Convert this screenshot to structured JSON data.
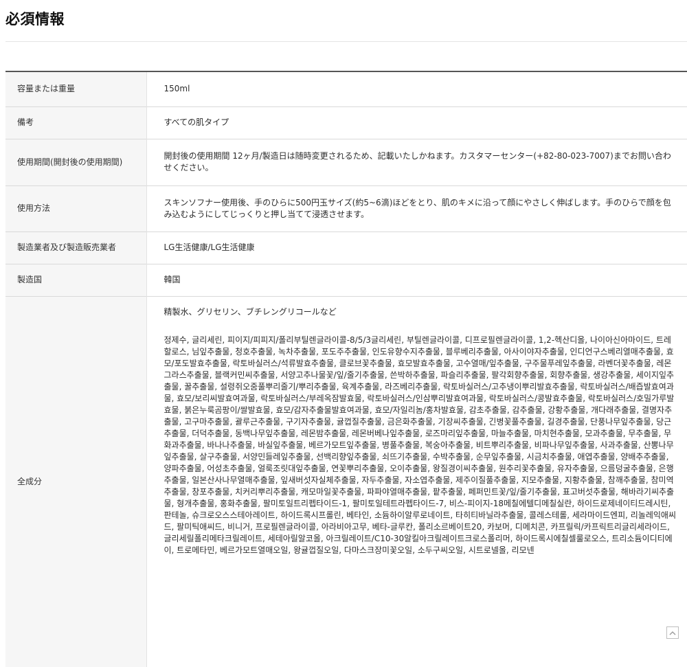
{
  "page": {
    "title": "必須情報"
  },
  "rows": [
    {
      "label": "容量または重量",
      "value": "150ml"
    },
    {
      "label": "備考",
      "value": "すべての肌タイプ"
    },
    {
      "label": "使用期間(開封後の使用期間)",
      "value": "開封後の使用期間 12ヶ月/製造日は随時変更されるため、記載いたしかねます。カスタマーセンター(+82-80-023-7007)までお問い合わせください。"
    },
    {
      "label": "使用方法",
      "value": "スキンソフナー使用後、手のひらに500円玉サイズ(約5~6滴)ほどをとり、肌のキメに沿って顔にやさしく伸ばします。手のひらで顔を包み込むようにしてじっくりと押し当てて浸透させます。"
    },
    {
      "label": "製造業者及び製造販売業者",
      "value": "LG生活健康/LG生活健康"
    },
    {
      "label": "製造国",
      "value": "韓国"
    }
  ],
  "ingredients": {
    "label": "全成分",
    "summary_ja": "精製水、グリセリン、ブチレングリコールなど",
    "full_ko": "정제수, 글리세린, 피이지/피피지/폴리부틸렌글라이콜-8/5/3글리세린, 부틸렌글라이콜, 디프로필렌글라이콜, 1,2-헥산디올, 나이아신아마이드, 트레할로스, 님잎추출물, 청호추출물, 녹차추출물, 포도주추출물, 인도유향수지추출물, 블루베리추출물, 아사이야자추출물, 인디언구스베리열매추출물, 효모/포도발효추출물, 락토바실러스/석류발효추출물, 클로브꽃추출물, 효모발효추출물, 고수열매/잎추출물, 구주물푸레잎추출물, 라벤더꽃추출물, 레몬그라스추출물, 블랙커민씨추출물, 서양고추나물꽃/잎/줄기추출물, 쓴박하추출물, 파슬리추출물, 팔각회향추출물, 회향추출물, 생강추출물, 세이지잎추출물, 꿀추출물, 설령쥐오줌풀뿌리줄기/뿌리추출물, 육계추출물, 라즈베리추출물, 락토바실러스/고추냉이뿌리발효추출물, 락토바실러스/배즙발효여과물, 효모/보리씨발효여과물, 락토바실러스/부레옥잠발효물, 락토바실러스/인삼뿌리발효여과물, 락토바실러스/콩발효추출물, 락토바실러스/호밀가루발효물, 붉은누룩곰팡이/쌀발효물, 효모/감자추출물발효여과물, 효모/자일리놈/홍차발효물, 감초추출물, 감추출물, 강황추출물, 개다래추출물, 결명자추출물, 고구마추출물, 괄루근추출물, 구기자추출물, 귤껍질추출물, 금은화추출물, 기장씨추출물, 긴병꽃풀추출물, 길경추출물, 단풍나무잎추출물, 당근추출물, 더덕추출물, 동백나무잎추출물, 레몬밤추출물, 레몬버베나잎추출물, 로즈마리잎추출물, 마늘추출물, 마치현추출물, 모과추출물, 무추출물, 무화과추출물, 바나나추출물, 바실잎추출물, 베르가모트잎추출물, 병풀추출물, 복숭아추출물, 비트뿌리추출물, 비파나무잎추출물, 사과추출물, 산뽕나무잎추출물, 살구추출물, 서양민들레잎추출물, 선백리향잎추출물, 쇠뜨기추출물, 수박추출물, 순무잎추출물, 시금치추출물, 애엽추출물, 양배추추출물, 양파추출물, 어성초추출물, 얼룩조릿대잎추출물, 연꽃뿌리추출물, 오이추출물, 왕질경이씨추출물, 원추리꽃추출물, 유자추출물, 으름덩굴추출물, 은행추출물, 일본산사나무열매추출물, 잎새버섯자실체추출물, 자두추출물, 자소엽추출물, 제주이질풀추출물, 지모추출물, 지황추출물, 참깨추출물, 참미역추출물, 창포추출물, 치커리뿌리추출물, 캐모마일꽃추출물, 파파야열매추출물, 팥추출물, 페퍼민트꽃/잎/줄기추출물, 표고버섯추출물, 해바라기씨추출물, 형개추출물, 홍화추출물, 팔미토일트리펩타이드-1, 팔미토일테트라펩타이드-7, 비스-피이지-18메칠에텔디메칠실란, 하이드로제네이티드레시틴, 판테놀, 슈크로오스스테아레이트, 하이드록시프롤린, 베타인, 소듐하이알루로네이트, 타히티바닐라추출물, 콜레스테롤, 세라마이드엔피, 리놀레익애씨드, 팔미틱애씨드, 비니거, 프로필렌글라이콜, 아라비아고무, 베타-글루칸, 폴리소르베이트20, 카보머, 디메치콘, 카프릴릭/카프릭트리글리세라이드, 글리세릴폴리메타크릴레이트, 세테아릴알코올, 아크릴레이트/C10-30알킬아크릴레이트크로스폴리머, 하이드록시에칠셀룰로오스, 트리소듐이디티에이, 트로메타민, 베르가모트열매오일, 왕귤껍질오일, 다마스크장미꽃오일, 소두구씨오일, 시트로넬올, 리모넨"
  }
}
